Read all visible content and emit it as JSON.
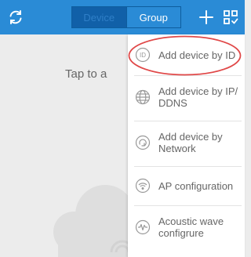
{
  "header": {
    "tabs": [
      {
        "label": "Device",
        "active": true
      },
      {
        "label": "Group",
        "active": false
      }
    ],
    "icons": {
      "refresh": "refresh-icon",
      "add": "plus-icon",
      "scan": "qr-scan-icon"
    }
  },
  "main": {
    "hint_text": "Tap to a"
  },
  "menu": {
    "items": [
      {
        "label": "Add device by ID",
        "icon": "id-icon"
      },
      {
        "label": "Add device by IP/ DDNS",
        "icon": "globe-icon"
      },
      {
        "label": "Add device by Network",
        "icon": "network-icon"
      },
      {
        "label": "AP configuration",
        "icon": "wifi-icon"
      },
      {
        "label": "Acoustic wave configrure",
        "icon": "sound-wave-icon"
      }
    ]
  },
  "colors": {
    "header_bg": "#2a8bd6",
    "active_tab_bg": "#1160a8",
    "highlight_ring": "#e04848",
    "menu_text": "#666666"
  }
}
